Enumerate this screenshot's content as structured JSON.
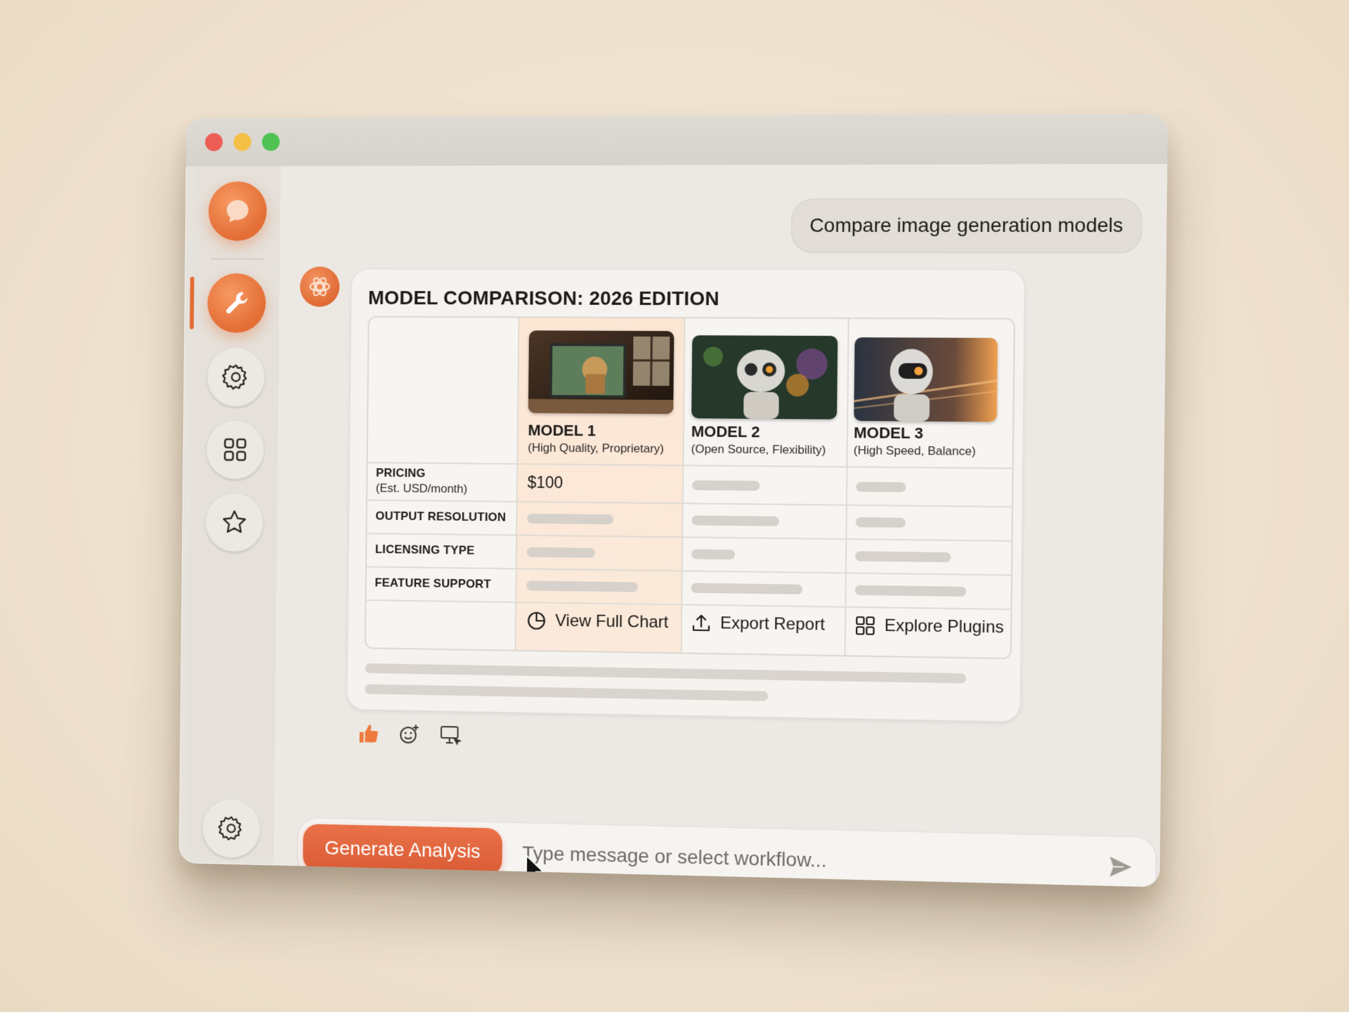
{
  "window": {
    "traffic_lights": [
      "close",
      "minimize",
      "maximize"
    ]
  },
  "sidebar": {
    "items": [
      {
        "icon": "chat-bubble-icon",
        "active": false
      },
      {
        "icon": "wrench-icon",
        "active": true
      },
      {
        "icon": "gear-icon",
        "active": false
      },
      {
        "icon": "grid-icon",
        "active": false
      },
      {
        "icon": "star-icon",
        "active": false
      }
    ],
    "bottom_icon": "gear-icon"
  },
  "chat": {
    "user_message": "Compare image generation models",
    "bot_avatar_icon": "assistant-logo-icon"
  },
  "comparison": {
    "title": "MODEL COMPARISON: 2026 EDITION",
    "models": [
      {
        "name": "MODEL 1",
        "subtitle": "(High Quality, Proprietary)"
      },
      {
        "name": "MODEL 2",
        "subtitle": "(Open Source, Flexibility)"
      },
      {
        "name": "MODEL 3",
        "subtitle": "(High Speed, Balance)"
      }
    ],
    "rows": [
      {
        "label": "PRICING",
        "sublabel": "(Est. USD/month)",
        "values": [
          "$100",
          "",
          ""
        ]
      },
      {
        "label": "OUTPUT RESOLUTION",
        "values": [
          "",
          "",
          ""
        ]
      },
      {
        "label": "LICENSING TYPE",
        "values": [
          "",
          "",
          ""
        ]
      },
      {
        "label": "FEATURE SUPPORT",
        "values": [
          "",
          "",
          ""
        ]
      }
    ],
    "actions": [
      {
        "label": "View Full Chart",
        "icon": "pie-chart-icon"
      },
      {
        "label": "Export Report",
        "icon": "upload-icon"
      },
      {
        "label": "Explore Plugins",
        "icon": "grid-icon"
      }
    ]
  },
  "reactions": [
    "thumbs-up-icon",
    "add-emoji-icon",
    "present-icon"
  ],
  "composer": {
    "button_label": "Generate Analysis",
    "placeholder": "Type message or select workflow...",
    "send_icon": "send-icon"
  },
  "colors": {
    "accent": "#e36d35",
    "highlight_column": "#fbe6d4"
  }
}
